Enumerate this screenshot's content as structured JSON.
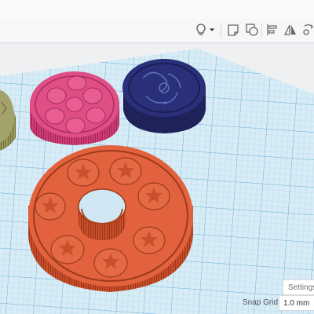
{
  "toolbar": {
    "icons": [
      "lightbulb-icon",
      "dropdown-caret-icon",
      "note-icon",
      "group-icon",
      "align-icon",
      "mirror-icon",
      "flip-icon"
    ]
  },
  "viewport": {
    "objects": [
      {
        "name": "green-gear-part",
        "color": "#a3a26a"
      },
      {
        "name": "pink-flower-disc",
        "color": "#e04e86"
      },
      {
        "name": "navy-pattern-disc",
        "color": "#2a2f79"
      },
      {
        "name": "orange-star-ring",
        "color": "#e2623d"
      }
    ],
    "grid_color": "#8fc8e6"
  },
  "settings": {
    "label": "Settings"
  },
  "snap_grid": {
    "label": "Snap Grid",
    "value": "1.0 mm"
  }
}
